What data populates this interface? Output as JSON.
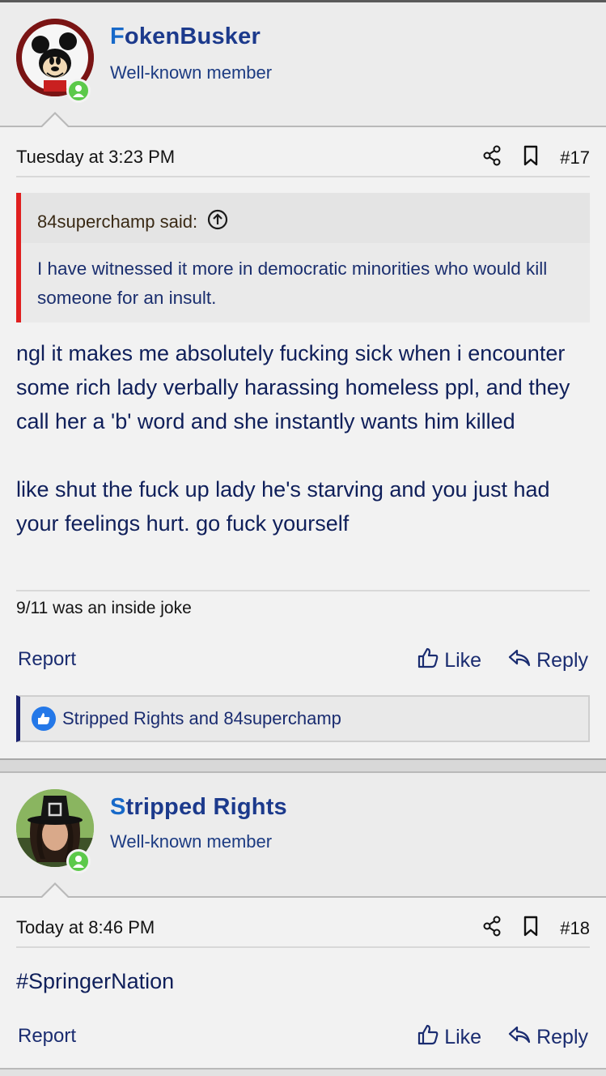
{
  "posts": [
    {
      "user": {
        "first_letter": "F",
        "rest_name": "okenBusker",
        "title": "Well-known member"
      },
      "date": "Tuesday at 3:23 PM",
      "number": "#17",
      "quote": {
        "author": "84superchamp said:",
        "text": "I have witnessed it more in democratic minorities who would kill someone for an insult."
      },
      "message": "ngl it makes me absolutely fucking sick when i encounter some rich lady verbally harassing homeless ppl, and they call her a 'b' word and she instantly wants him killed\n\nlike shut the fuck up lady he's starving and you just had your feelings hurt. go fuck yourself",
      "signature": "9/11 was an inside joke",
      "report_label": "Report",
      "like_label": "Like",
      "reply_label": "Reply",
      "reactions": "Stripped Rights and 84superchamp"
    },
    {
      "user": {
        "first_letter": "S",
        "rest_name": "tripped Rights",
        "title": "Well-known member"
      },
      "date": "Today at 8:46 PM",
      "number": "#18",
      "message": "#SpringerNation",
      "report_label": "Report",
      "like_label": "Like",
      "reply_label": "Reply"
    }
  ],
  "icons": {
    "share": "share-icon",
    "bookmark": "bookmark-icon",
    "like": "thumbs-up-icon",
    "reply": "reply-arrow-icon",
    "quote_jump": "arrow-up-circle-icon",
    "online": "online-status-icon"
  },
  "colors": {
    "quote_border": "#e02020",
    "online": "#5cc94a",
    "reaction_badge": "#2478e8",
    "username_first_letter": "#1769c9",
    "username": "#1c3a8c"
  }
}
